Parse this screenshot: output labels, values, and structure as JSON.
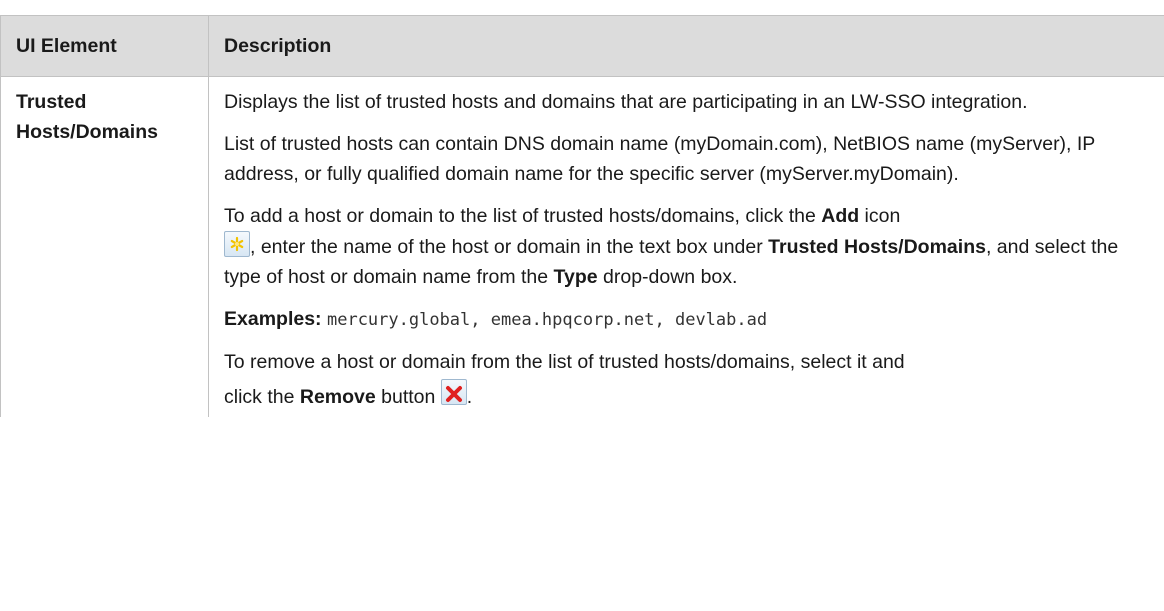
{
  "header": {
    "col1": "UI Element",
    "col2": "Description"
  },
  "row": {
    "element_line1": "Trusted",
    "element_line2": "Hosts/Domains",
    "p1": "Displays the list of trusted hosts and domains that are participating in an LW-SSO integration.",
    "p2": "List of trusted hosts can contain DNS domain name (myDomain.com), NetBIOS name (myServer), IP address, or fully qualified domain name for the specific server (myServer.myDomain).",
    "p3": {
      "t1": "To add a host or domain to the list of trusted hosts/domains, click the ",
      "b1": "Add",
      "t2": " icon",
      "t3": ", enter the name of the host or domain in the text box under ",
      "b2": "Trusted Hosts/Domains",
      "t4": ", and select the type of host or domain name from the ",
      "b3": "Type",
      "t5": " drop-down box."
    },
    "p4": {
      "label": "Examples:",
      "code": "mercury.global, emea.hpqcorp.net, devlab.ad"
    },
    "p5": {
      "t1": "To remove a host or domain from the list of trusted hosts/domains, select it and click the ",
      "b1": "Remove",
      "t2": " button",
      "t3": "."
    }
  },
  "icons": {
    "add": "add-asterisk-icon",
    "remove": "remove-x-icon",
    "add_color": "#f2c200",
    "remove_color": "#e02020"
  }
}
